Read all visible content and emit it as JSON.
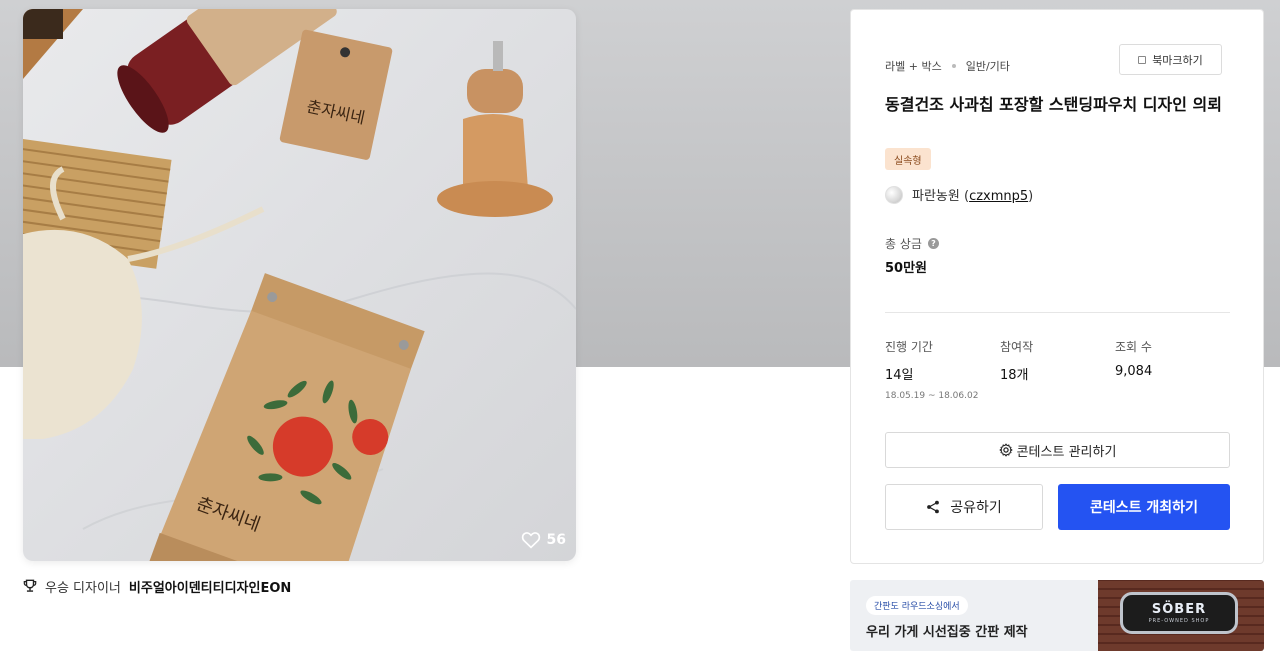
{
  "product": {
    "likes": "56",
    "package_brand": "춘자씨네"
  },
  "winner": {
    "label": "우승 디자이너",
    "name": "비주얼아이덴티티디자인EON"
  },
  "contest": {
    "category": "라벨 + 박스",
    "subcategory": "일반/기타",
    "bookmark_label": "북마크하기",
    "title": "동결건조 사과칩 포장할 스탠딩파우치 디자인 의뢰",
    "tag": "실속형",
    "host_name": "파란농원",
    "host_id": "czxmnp5",
    "prize_label": "총 상금",
    "prize_help": "?",
    "prize_value": "50만원",
    "stats": {
      "period_label": "진행 기간",
      "period_value": "14일",
      "period_dates": "18.05.19 ~ 18.06.02",
      "entries_label": "참여작",
      "entries_value": "18개",
      "views_label": "조회 수",
      "views_value": "9,084"
    },
    "manage_label": "콘테스트 관리하기",
    "share_label": "공유하기",
    "host_contest_label": "콘테스트 개최하기",
    "accent_color": "#2453f2",
    "tag_color": "#fbe3cf"
  },
  "ad": {
    "chip": "간판도 라우드소싱에서",
    "headline": "우리 가게 시선집중 간판 제작",
    "sign_name": "SÖBER",
    "sign_sub": "PRE-OWNED SHOP"
  }
}
